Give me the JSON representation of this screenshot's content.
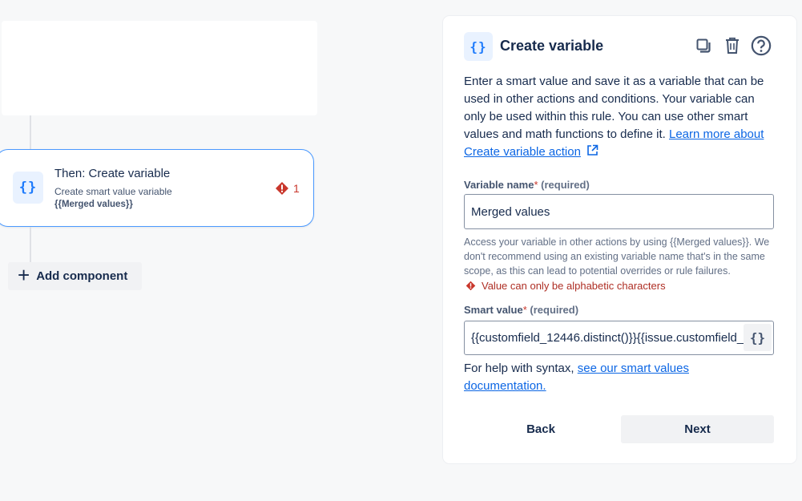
{
  "canvas": {
    "rule_card": {
      "icon_glyph": "{}",
      "title": "Then: Create variable",
      "subtitle": "Create smart value variable",
      "smart_value": "{{Merged values}}",
      "error_count": "1"
    },
    "add_component_label": "Add component"
  },
  "panel": {
    "icon_glyph": "{}",
    "title": "Create variable",
    "description_text": "Enter a smart value and save it as a variable that can be used in other actions and conditions. Your variable can only be used within this rule. You can use other smart values and math functions to define it. ",
    "description_link": "Learn more about Create variable action",
    "variable_name": {
      "label": "Variable name",
      "required_mark": "*",
      "required_text": "(required)",
      "value": "Merged values",
      "help": "Access your variable in other actions by using {{Merged values}}. We don't recommend using an existing variable name that's in the same scope, as this can lead to potential overrides or rule failures.",
      "error": "Value can only be alphabetic characters"
    },
    "smart_value": {
      "label": "Smart value",
      "required_mark": "*",
      "required_text": "(required)",
      "value": "{{customfield_12446.distinct()}}{{issue.customfield_",
      "insert_button_glyph": "{}"
    },
    "syntax_help_text": "For help with syntax, ",
    "syntax_help_link": "see our smart values documentation.",
    "back_label": "Back",
    "next_label": "Next"
  },
  "colors": {
    "accent": "#1d7afc",
    "link": "#0c66e4",
    "error": "#c9372c",
    "card_border": "#4c9aff",
    "background": "#f7f8f9"
  },
  "icons": [
    "curly-braces-icon",
    "error-icon",
    "plus-icon",
    "duplicate-icon",
    "trash-icon",
    "help-icon",
    "external-link-icon"
  ]
}
